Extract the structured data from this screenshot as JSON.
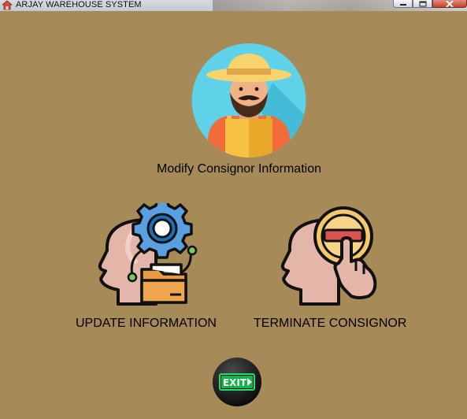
{
  "window": {
    "title": "ARJAY WAREHOUSE SYSTEM",
    "icons": {
      "app": "house-icon",
      "minimize": "minimize-icon",
      "maximize": "maximize-icon",
      "close": "close-icon"
    }
  },
  "main": {
    "header_icon": "farmer-avatar-icon",
    "header_label": "Modify Consignor Information",
    "actions": [
      {
        "label": "UPDATE INFORMATION",
        "icon": "head-gear-folder-icon"
      },
      {
        "label": "TERMINATE CONSIGNOR",
        "icon": "head-minus-hand-icon"
      }
    ],
    "exit_label": "EXIT"
  },
  "colors": {
    "background": "#a68a57",
    "exit_green": "#00c853"
  }
}
